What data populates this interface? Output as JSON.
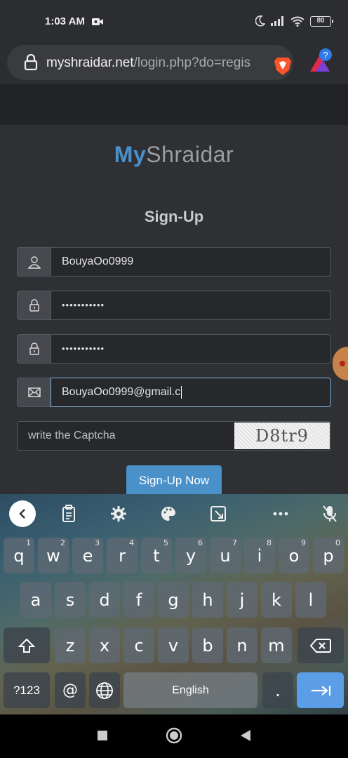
{
  "status_bar": {
    "time": "1:03 AM",
    "battery": "80",
    "icons": [
      "video-camera-icon",
      "moon-icon",
      "signal-icon",
      "wifi-icon",
      "battery-icon"
    ]
  },
  "browser": {
    "url_domain": "myshraidar.net",
    "url_path": "/login.php?do=regis",
    "icons": [
      "lock-icon",
      "brave-shield-icon",
      "extension-icon"
    ]
  },
  "page": {
    "brand_my": "My",
    "brand_rest": "Shraidar",
    "title": "Sign-Up",
    "fields": {
      "username": "BouyaOo0999",
      "password": "•••••••••••",
      "confirm_password": "•••••••••••",
      "email": "BouyaOo0999@gmail.c"
    },
    "captcha_placeholder": "write the Captcha",
    "captcha_image_text": "D8tr9",
    "signup_button": "Sign-Up Now"
  },
  "keyboard": {
    "row1": [
      {
        "label": "q",
        "hint": "1"
      },
      {
        "label": "w",
        "hint": "2"
      },
      {
        "label": "e",
        "hint": "3"
      },
      {
        "label": "r",
        "hint": "4"
      },
      {
        "label": "t",
        "hint": "5"
      },
      {
        "label": "y",
        "hint": "6"
      },
      {
        "label": "u",
        "hint": "7"
      },
      {
        "label": "i",
        "hint": "8"
      },
      {
        "label": "o",
        "hint": "9"
      },
      {
        "label": "p",
        "hint": "0"
      }
    ],
    "row2": [
      "a",
      "s",
      "d",
      "f",
      "g",
      "h",
      "j",
      "k",
      "l"
    ],
    "row3": [
      "z",
      "x",
      "c",
      "v",
      "b",
      "n",
      "m"
    ],
    "symbols_key": "?123",
    "at_key": "@",
    "space_label": "English",
    "period_key": ".",
    "accent_color": "#5b9de6"
  }
}
